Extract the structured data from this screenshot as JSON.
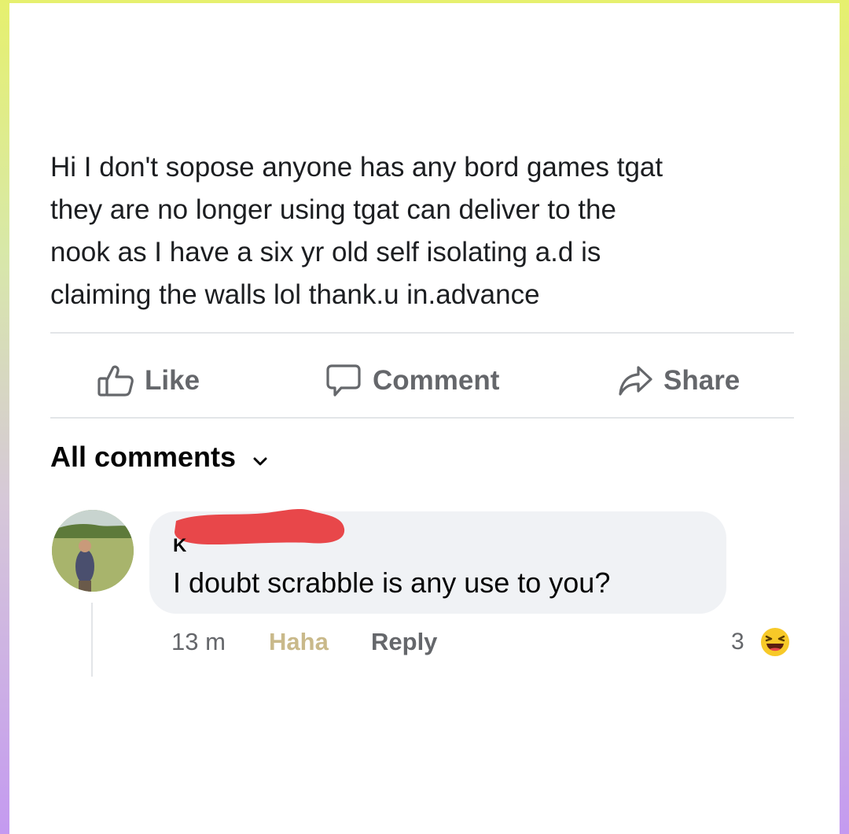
{
  "post": {
    "lines": [
      "Hi I don't sopose anyone has any bord games tgat",
      "they are no longer using tgat can deliver to the",
      "nook as I have a six yr old self isolating a.d is",
      "claiming the walls lol  thank.u in.advance"
    ]
  },
  "actions": {
    "like": "Like",
    "comment": "Comment",
    "share": "Share"
  },
  "comments_filter": {
    "label": "All comments"
  },
  "comment": {
    "author_initial": "K",
    "text": "I doubt scrabble is any use to you?",
    "time": "13 m",
    "reacted_label": "Haha",
    "reply_label": "Reply",
    "reaction_count": "3",
    "reaction_icon": "haha-emoji-icon"
  },
  "colors": {
    "muted_text": "#65676b",
    "haha_label": "#c9b98a",
    "bubble": "#f0f2f5",
    "redaction": "#e8474a",
    "emoji_yellow": "#f7c928"
  }
}
